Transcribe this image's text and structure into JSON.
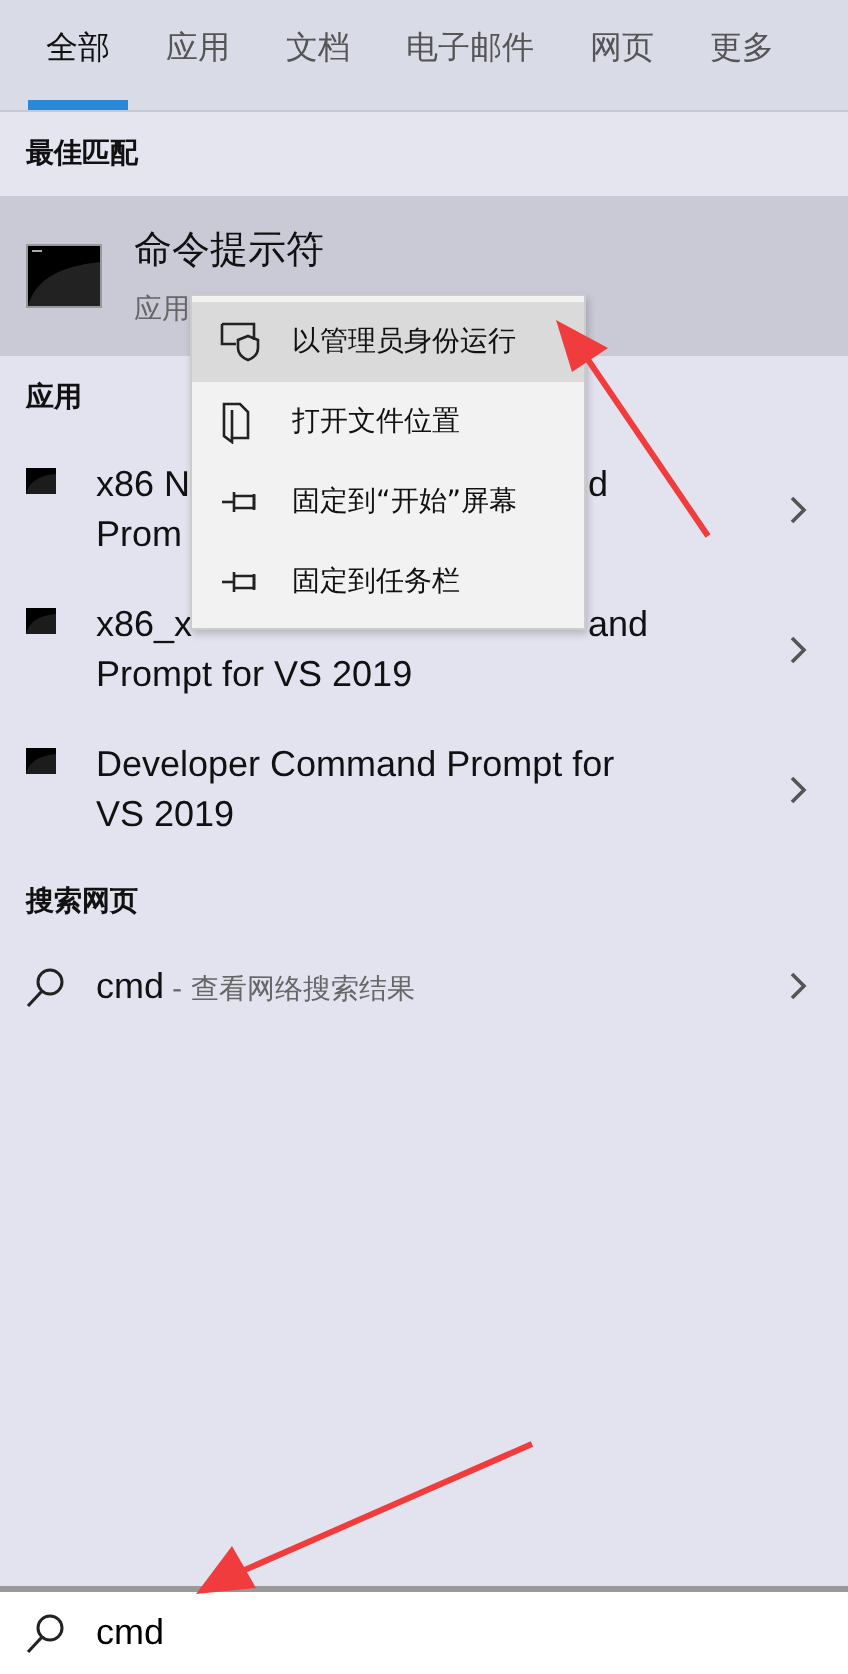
{
  "tabs": [
    {
      "label": "全部",
      "selected": true
    },
    {
      "label": "应用",
      "selected": false
    },
    {
      "label": "文档",
      "selected": false
    },
    {
      "label": "电子邮件",
      "selected": false
    },
    {
      "label": "网页",
      "selected": false
    },
    {
      "label": "更多",
      "selected": false
    }
  ],
  "best_match": {
    "heading": "最佳匹配",
    "title": "命令提示符",
    "subtitle": "应用",
    "selected": true
  },
  "apps": {
    "heading": "应用",
    "items": [
      {
        "lines": [
          [
            "x86 N",
            "d"
          ],
          [
            "Prom"
          ]
        ]
      },
      {
        "lines": [
          [
            "x86_x",
            "and"
          ],
          [
            "Prompt for VS 2019"
          ]
        ]
      },
      {
        "lines": [
          [
            "Developer Command Prompt for"
          ],
          [
            "VS 2019"
          ]
        ]
      }
    ]
  },
  "web": {
    "heading": "搜索网页",
    "query": "cmd",
    "hint": "- 查看网络搜索结果"
  },
  "context_menu": [
    {
      "kind": "admin",
      "label": "以管理员身份运行",
      "selected": true
    },
    {
      "kind": "folder",
      "label": "打开文件位置",
      "selected": false
    },
    {
      "kind": "pin",
      "label": "固定到“开始”屏幕",
      "selected": false
    },
    {
      "kind": "pin",
      "label": "固定到任务栏",
      "selected": false
    }
  ],
  "search": {
    "value": "cmd"
  }
}
